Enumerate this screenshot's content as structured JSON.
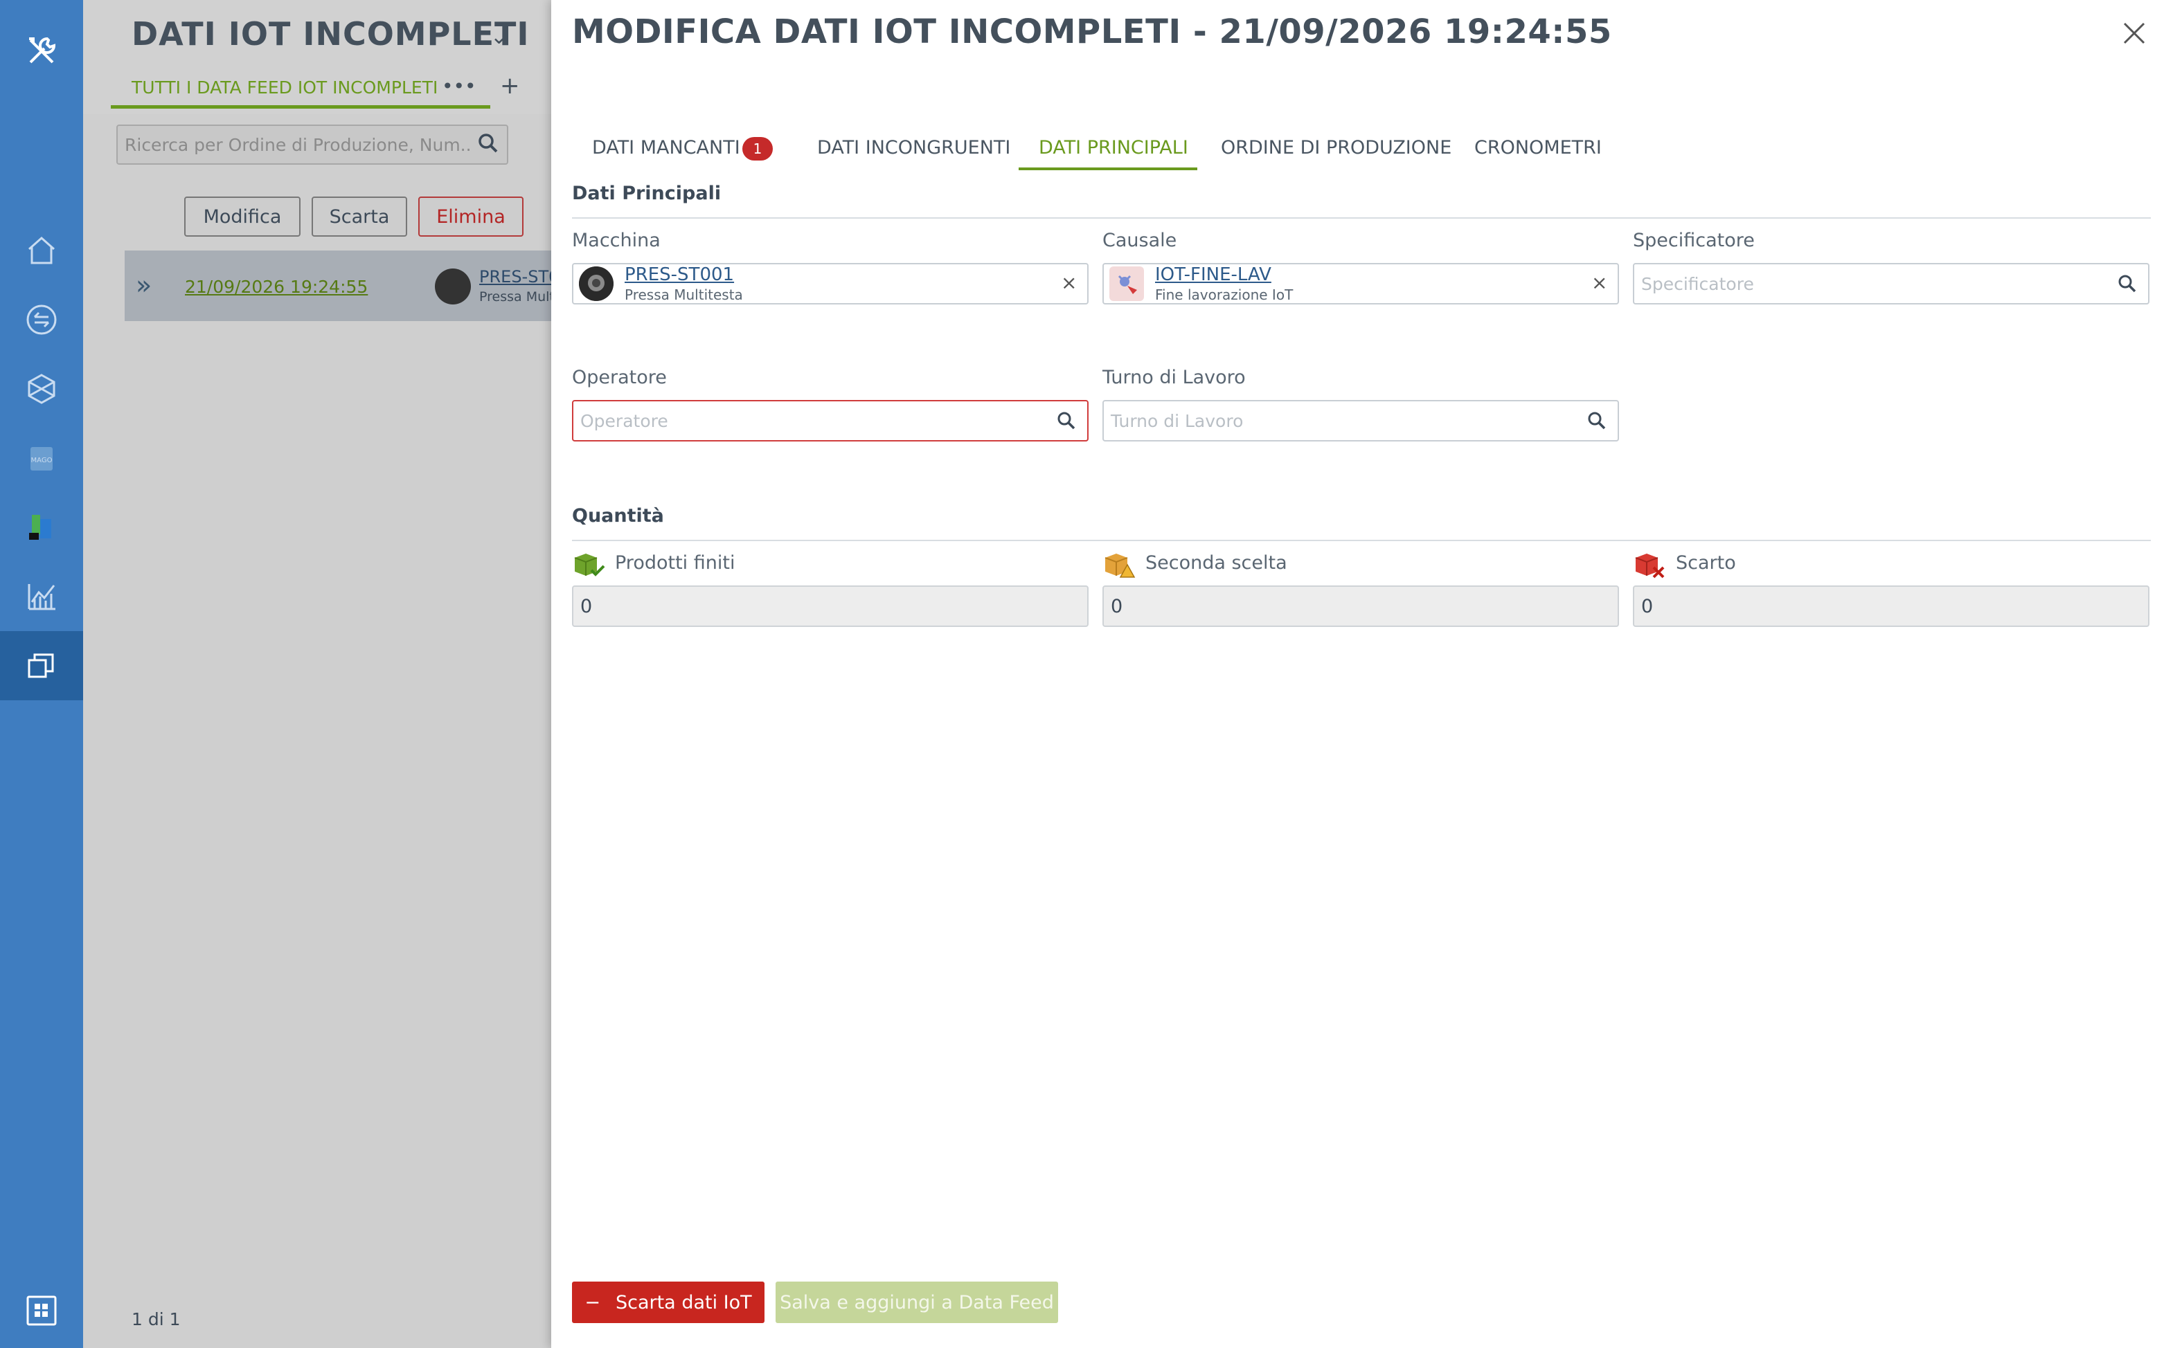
{
  "background": {
    "title": "DATI IOT INCOMPLETI",
    "tab_label": "TUTTI I DATA FEED IOT INCOMPLETI",
    "tab_more": "•••",
    "tab_add": "+",
    "search_placeholder": "Ricerca per Ordine di Produzione, Num...",
    "buttons": {
      "edit": "Modifica",
      "discard": "Scarta",
      "delete": "Elimina"
    },
    "row": {
      "date": "21/09/2026 19:24:55",
      "machine_code": "PRES-ST0",
      "machine_name": "Pressa Mult"
    },
    "pagination": "1 di 1"
  },
  "dialog": {
    "title": "MODIFICA DATI IOT INCOMPLETI - 21/09/2026 19:24:55",
    "tabs": [
      {
        "label": "DATI MANCANTI",
        "badge": "1"
      },
      {
        "label": "DATI INCONGRUENTI"
      },
      {
        "label": "DATI PRINCIPALI",
        "active": true
      },
      {
        "label": "ORDINE DI PRODUZIONE"
      },
      {
        "label": "CRONOMETRI"
      }
    ],
    "main_section": "Dati Principali",
    "fields": {
      "machine": {
        "label": "Macchina",
        "code": "PRES-ST001",
        "name": "Pressa Multitesta"
      },
      "reason": {
        "label": "Causale",
        "code": "IOT-FINE-LAV",
        "name": "Fine lavorazione IoT"
      },
      "specifier": {
        "label": "Specificatore",
        "placeholder": "Specificatore"
      },
      "operator": {
        "label": "Operatore",
        "placeholder": "Operatore"
      },
      "shift": {
        "label": "Turno di Lavoro",
        "placeholder": "Turno di Lavoro"
      }
    },
    "quantity_section": "Quantità",
    "quantities": {
      "finished": {
        "label": "Prodotti finiti",
        "value": "0"
      },
      "second": {
        "label": "Seconda scelta",
        "value": "0"
      },
      "scrap": {
        "label": "Scarto",
        "value": "0"
      }
    },
    "footer": {
      "discard_label": "Scarta dati IoT",
      "discard_icon": "−",
      "save_label": "Salva e aggiungi a Data Feed"
    }
  },
  "colors": {
    "accent": "#6a9a1e",
    "danger": "#c8261f",
    "sidebar": "#3f7dc0"
  }
}
